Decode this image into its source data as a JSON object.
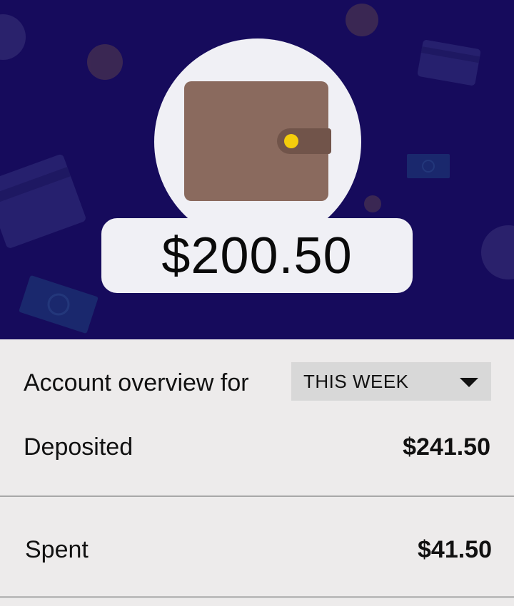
{
  "theme": {
    "hero_background": "#160b5c",
    "card_background": "#f0f0f5",
    "wallet_color": "#8a6a5e",
    "wallet_clasp_color": "#71544a",
    "wallet_button_color": "#f4cd0c",
    "overview_background": "#edebeb"
  },
  "hero": {
    "icon": "wallet-icon",
    "balance": "$200.50"
  },
  "overview": {
    "label": "Account overview for",
    "period": {
      "selected": "THIS WEEK"
    },
    "rows": [
      {
        "label": "Deposited",
        "value": "$241.50"
      },
      {
        "label": "Spent",
        "value": "$41.50"
      }
    ]
  }
}
